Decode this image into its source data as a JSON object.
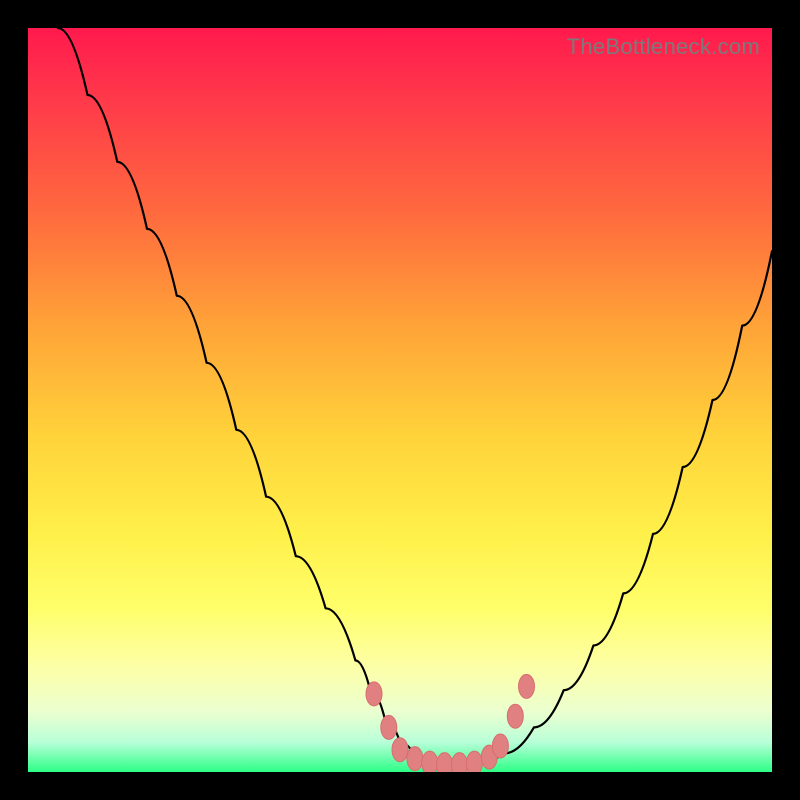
{
  "watermark": "TheBottleneck.com",
  "colors": {
    "frame": "#000000",
    "curve": "#000000",
    "marker_fill": "#e08080",
    "marker_stroke": "#d86e6e",
    "gradient": [
      "#ff1a4d",
      "#ff3a4a",
      "#ff6a3e",
      "#ffa338",
      "#ffd33a",
      "#fff04a",
      "#ffff6a",
      "#fdffa8",
      "#eaffd0",
      "#b8ffd8",
      "#2cff86"
    ]
  },
  "chart_data": {
    "type": "line",
    "title": "",
    "xlabel": "",
    "ylabel": "",
    "xlim": [
      0,
      100
    ],
    "ylim": [
      0,
      100
    ],
    "grid": false,
    "legend": false,
    "series": [
      {
        "name": "bottleneck-curve",
        "x": [
          4,
          8,
          12,
          16,
          20,
          24,
          28,
          32,
          36,
          40,
          44,
          46,
          48,
          50,
          52,
          54,
          56,
          58,
          60,
          64,
          68,
          72,
          76,
          80,
          84,
          88,
          92,
          96,
          100
        ],
        "y": [
          100,
          91,
          82,
          73,
          64,
          55,
          46,
          37,
          29,
          22,
          15,
          11,
          7,
          4,
          2.2,
          1.2,
          1,
          1,
          1.1,
          2.5,
          6,
          11,
          17,
          24,
          32,
          41,
          50,
          60,
          70
        ]
      }
    ],
    "markers": [
      {
        "x": 46.5,
        "y": 10.5
      },
      {
        "x": 48.5,
        "y": 6.0
      },
      {
        "x": 50.0,
        "y": 3.0
      },
      {
        "x": 52.0,
        "y": 1.8
      },
      {
        "x": 54.0,
        "y": 1.2
      },
      {
        "x": 56.0,
        "y": 1.0
      },
      {
        "x": 58.0,
        "y": 1.0
      },
      {
        "x": 60.0,
        "y": 1.2
      },
      {
        "x": 62.0,
        "y": 2.0
      },
      {
        "x": 63.5,
        "y": 3.5
      },
      {
        "x": 65.5,
        "y": 7.5
      },
      {
        "x": 67.0,
        "y": 11.5
      }
    ],
    "annotations": []
  }
}
